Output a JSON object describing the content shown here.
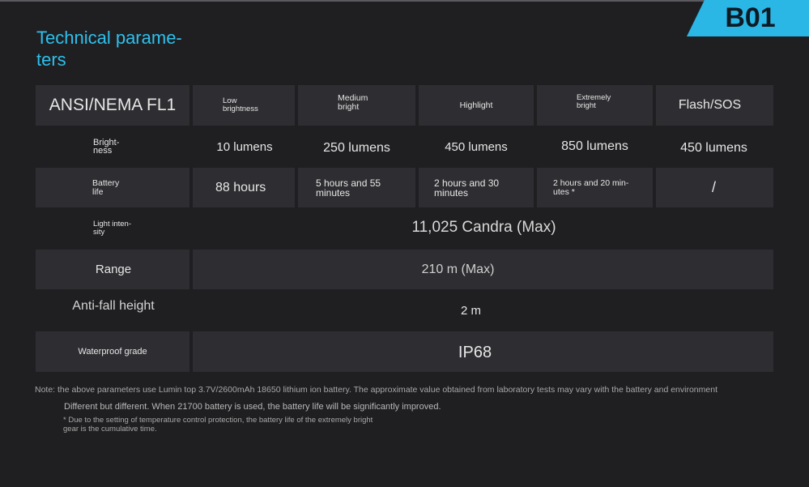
{
  "badge": "B01",
  "title": "Technical parame-\nters",
  "table": {
    "header": {
      "label": "ANSI/NEMA FL1",
      "modes": [
        "Low\nbrightness",
        "Medium\nbright",
        "Highlight",
        "Extremely\nbright",
        "Flash/SOS"
      ]
    },
    "brightness": {
      "label": "Bright-\nness",
      "values": [
        "10 lumens",
        "250 lumens",
        "450 lumens",
        "850 lumens",
        "450 lumens"
      ]
    },
    "battery": {
      "label": "Battery\nlife",
      "values": [
        "88 hours",
        "5 hours and 55\nminutes",
        "2 hours and 30\nminutes",
        "2 hours and 20 min-\nutes *",
        "/"
      ]
    },
    "intensity": {
      "label": "Light inten-\nsity",
      "value": "11,025 Candra (Max)"
    },
    "range": {
      "label": "Range",
      "value": "210 m (Max)"
    },
    "antifall": {
      "label": "Anti-fall height",
      "value": "2 m"
    },
    "waterproof": {
      "label": "Waterproof grade",
      "value": "IP68"
    }
  },
  "notes": {
    "line1": "Note: the above parameters use Lumin top 3.7V/2600mAh 18650 lithium ion battery. The approximate value obtained from laboratory tests may vary with the battery and environment",
    "line2": "Different but different. When 21700 battery is used, the battery life will be significantly improved.",
    "line3": "* Due to the setting of temperature control protection, the battery life of the extremely bright\ngear is the cumulative time."
  },
  "colors": {
    "accent": "#2ec0ec",
    "badge": "#2bb7e6",
    "background": "#1f1f22",
    "cell": "#2e2e32"
  }
}
